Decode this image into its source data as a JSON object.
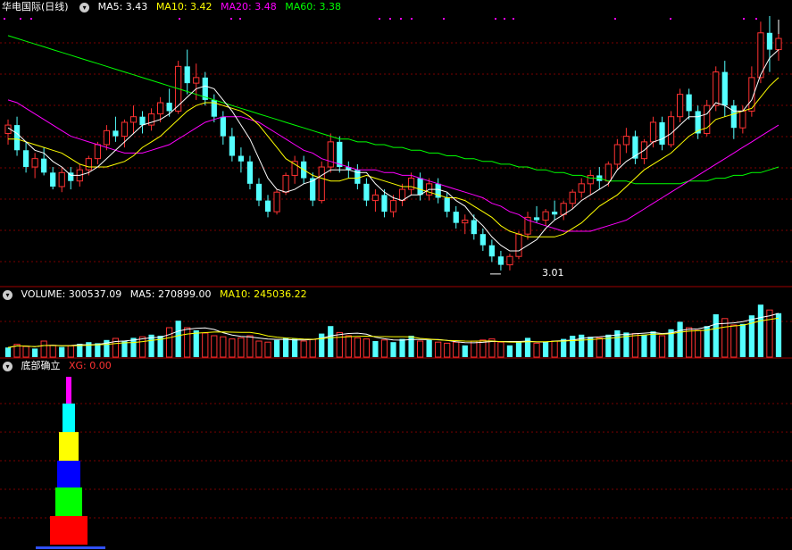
{
  "price_panel": {
    "title": "华电国际(日线)",
    "ma5_label": "MA5: 3.43",
    "ma10_label": "MA10: 3.42",
    "ma20_label": "MA20: 3.48",
    "ma60_label": "MA60: 3.38",
    "low_marker": "3.01",
    "colors": {
      "ma5": "#ffffff",
      "ma10": "#ffff00",
      "ma20": "#ff00ff",
      "ma60": "#00ff00",
      "up": "#ff3232",
      "down": "#54ffff"
    }
  },
  "volume_panel": {
    "volume_label": "VOLUME: 300537.09",
    "ma5_label": "MA5: 270899.00",
    "ma10_label": "MA10: 245036.22"
  },
  "indicator_panel": {
    "title": "底部确立",
    "xg_label": "XG: 0.00",
    "tower_colors": [
      "#ff0000",
      "#00ff00",
      "#0000ff",
      "#ffff00",
      "#00ffff",
      "#ff00ff"
    ]
  },
  "chart_data": {
    "type": "candlestick",
    "title": "华电国际(日线)",
    "candles": [
      [
        3.5,
        3.55,
        3.46,
        3.53
      ],
      [
        3.53,
        3.56,
        3.42,
        3.44
      ],
      [
        3.44,
        3.47,
        3.36,
        3.38
      ],
      [
        3.38,
        3.43,
        3.34,
        3.41
      ],
      [
        3.41,
        3.45,
        3.35,
        3.36
      ],
      [
        3.36,
        3.38,
        3.3,
        3.31
      ],
      [
        3.31,
        3.38,
        3.29,
        3.36
      ],
      [
        3.36,
        3.38,
        3.3,
        3.33
      ],
      [
        3.33,
        3.39,
        3.31,
        3.37
      ],
      [
        3.37,
        3.42,
        3.35,
        3.41
      ],
      [
        3.41,
        3.47,
        3.39,
        3.46
      ],
      [
        3.46,
        3.53,
        3.44,
        3.51
      ],
      [
        3.51,
        3.56,
        3.47,
        3.49
      ],
      [
        3.49,
        3.55,
        3.45,
        3.54
      ],
      [
        3.54,
        3.6,
        3.5,
        3.56
      ],
      [
        3.56,
        3.58,
        3.5,
        3.53
      ],
      [
        3.53,
        3.59,
        3.51,
        3.57
      ],
      [
        3.57,
        3.63,
        3.54,
        3.61
      ],
      [
        3.61,
        3.66,
        3.56,
        3.58
      ],
      [
        3.58,
        3.76,
        3.57,
        3.74
      ],
      [
        3.74,
        3.8,
        3.64,
        3.68
      ],
      [
        3.68,
        3.75,
        3.62,
        3.7
      ],
      [
        3.7,
        3.72,
        3.6,
        3.62
      ],
      [
        3.62,
        3.64,
        3.54,
        3.56
      ],
      [
        3.56,
        3.58,
        3.46,
        3.49
      ],
      [
        3.49,
        3.52,
        3.4,
        3.42
      ],
      [
        3.42,
        3.45,
        3.36,
        3.4
      ],
      [
        3.4,
        3.42,
        3.3,
        3.32
      ],
      [
        3.32,
        3.34,
        3.24,
        3.26
      ],
      [
        3.26,
        3.28,
        3.2,
        3.22
      ],
      [
        3.22,
        3.3,
        3.21,
        3.29
      ],
      [
        3.29,
        3.36,
        3.28,
        3.35
      ],
      [
        3.35,
        3.42,
        3.32,
        3.4
      ],
      [
        3.4,
        3.42,
        3.32,
        3.34
      ],
      [
        3.34,
        3.36,
        3.24,
        3.26
      ],
      [
        3.26,
        3.4,
        3.25,
        3.38
      ],
      [
        3.38,
        3.5,
        3.36,
        3.47
      ],
      [
        3.47,
        3.49,
        3.36,
        3.38
      ],
      [
        3.38,
        3.4,
        3.34,
        3.37
      ],
      [
        3.37,
        3.39,
        3.3,
        3.32
      ],
      [
        3.32,
        3.34,
        3.24,
        3.26
      ],
      [
        3.26,
        3.3,
        3.22,
        3.28
      ],
      [
        3.28,
        3.3,
        3.2,
        3.22
      ],
      [
        3.22,
        3.28,
        3.2,
        3.26
      ],
      [
        3.26,
        3.32,
        3.24,
        3.3
      ],
      [
        3.3,
        3.36,
        3.28,
        3.34
      ],
      [
        3.34,
        3.36,
        3.26,
        3.28
      ],
      [
        3.28,
        3.34,
        3.26,
        3.32
      ],
      [
        3.32,
        3.34,
        3.25,
        3.27
      ],
      [
        3.27,
        3.29,
        3.2,
        3.22
      ],
      [
        3.22,
        3.24,
        3.16,
        3.18
      ],
      [
        3.18,
        3.21,
        3.14,
        3.19
      ],
      [
        3.19,
        3.21,
        3.12,
        3.14
      ],
      [
        3.14,
        3.16,
        3.08,
        3.1
      ],
      [
        3.1,
        3.12,
        3.04,
        3.06
      ],
      [
        3.06,
        3.08,
        3.01,
        3.03
      ],
      [
        3.03,
        3.07,
        3.01,
        3.06
      ],
      [
        3.06,
        3.15,
        3.05,
        3.14
      ],
      [
        3.14,
        3.22,
        3.12,
        3.2
      ],
      [
        3.2,
        3.24,
        3.18,
        3.19
      ],
      [
        3.19,
        3.23,
        3.17,
        3.22
      ],
      [
        3.22,
        3.26,
        3.19,
        3.21
      ],
      [
        3.21,
        3.26,
        3.19,
        3.25
      ],
      [
        3.25,
        3.3,
        3.23,
        3.29
      ],
      [
        3.29,
        3.34,
        3.27,
        3.32
      ],
      [
        3.32,
        3.37,
        3.28,
        3.35
      ],
      [
        3.35,
        3.38,
        3.3,
        3.33
      ],
      [
        3.33,
        3.4,
        3.31,
        3.39
      ],
      [
        3.39,
        3.48,
        3.37,
        3.46
      ],
      [
        3.46,
        3.52,
        3.43,
        3.49
      ],
      [
        3.49,
        3.51,
        3.39,
        3.41
      ],
      [
        3.41,
        3.48,
        3.39,
        3.47
      ],
      [
        3.47,
        3.56,
        3.45,
        3.54
      ],
      [
        3.54,
        3.56,
        3.44,
        3.46
      ],
      [
        3.46,
        3.58,
        3.45,
        3.56
      ],
      [
        3.56,
        3.66,
        3.54,
        3.64
      ],
      [
        3.64,
        3.66,
        3.55,
        3.58
      ],
      [
        3.58,
        3.6,
        3.48,
        3.5
      ],
      [
        3.5,
        3.62,
        3.49,
        3.6
      ],
      [
        3.6,
        3.74,
        3.58,
        3.72
      ],
      [
        3.72,
        3.76,
        3.56,
        3.6
      ],
      [
        3.6,
        3.62,
        3.48,
        3.52
      ],
      [
        3.52,
        3.6,
        3.5,
        3.58
      ],
      [
        3.58,
        3.74,
        3.56,
        3.7
      ],
      [
        3.7,
        3.9,
        3.68,
        3.86
      ],
      [
        3.86,
        3.92,
        3.72,
        3.8
      ],
      [
        3.8,
        3.86,
        3.76,
        3.84
      ]
    ],
    "volumes": [
      [
        false,
        0.18
      ],
      [
        true,
        0.24
      ],
      [
        true,
        0.2
      ],
      [
        false,
        0.16
      ],
      [
        true,
        0.3
      ],
      [
        true,
        0.22
      ],
      [
        false,
        0.19
      ],
      [
        true,
        0.21
      ],
      [
        false,
        0.25
      ],
      [
        false,
        0.28
      ],
      [
        false,
        0.26
      ],
      [
        false,
        0.32
      ],
      [
        true,
        0.35
      ],
      [
        false,
        0.3
      ],
      [
        false,
        0.36
      ],
      [
        true,
        0.38
      ],
      [
        false,
        0.42
      ],
      [
        false,
        0.4
      ],
      [
        true,
        0.55
      ],
      [
        false,
        0.68
      ],
      [
        true,
        0.55
      ],
      [
        false,
        0.5
      ],
      [
        true,
        0.45
      ],
      [
        true,
        0.4
      ],
      [
        true,
        0.38
      ],
      [
        true,
        0.34
      ],
      [
        true,
        0.36
      ],
      [
        true,
        0.4
      ],
      [
        true,
        0.3
      ],
      [
        true,
        0.28
      ],
      [
        false,
        0.32
      ],
      [
        false,
        0.36
      ],
      [
        false,
        0.34
      ],
      [
        true,
        0.3
      ],
      [
        true,
        0.33
      ],
      [
        false,
        0.44
      ],
      [
        false,
        0.58
      ],
      [
        true,
        0.46
      ],
      [
        true,
        0.4
      ],
      [
        true,
        0.36
      ],
      [
        true,
        0.34
      ],
      [
        false,
        0.3
      ],
      [
        true,
        0.32
      ],
      [
        false,
        0.28
      ],
      [
        false,
        0.34
      ],
      [
        false,
        0.4
      ],
      [
        true,
        0.3
      ],
      [
        false,
        0.32
      ],
      [
        true,
        0.28
      ],
      [
        true,
        0.26
      ],
      [
        true,
        0.28
      ],
      [
        false,
        0.22
      ],
      [
        true,
        0.3
      ],
      [
        true,
        0.32
      ],
      [
        true,
        0.34
      ],
      [
        true,
        0.28
      ],
      [
        false,
        0.22
      ],
      [
        false,
        0.3
      ],
      [
        false,
        0.36
      ],
      [
        true,
        0.26
      ],
      [
        false,
        0.28
      ],
      [
        true,
        0.3
      ],
      [
        false,
        0.34
      ],
      [
        false,
        0.4
      ],
      [
        false,
        0.42
      ],
      [
        false,
        0.38
      ],
      [
        true,
        0.36
      ],
      [
        false,
        0.42
      ],
      [
        false,
        0.5
      ],
      [
        false,
        0.46
      ],
      [
        true,
        0.44
      ],
      [
        false,
        0.42
      ],
      [
        false,
        0.48
      ],
      [
        true,
        0.4
      ],
      [
        false,
        0.52
      ],
      [
        false,
        0.66
      ],
      [
        true,
        0.55
      ],
      [
        true,
        0.5
      ],
      [
        false,
        0.58
      ],
      [
        false,
        0.8
      ],
      [
        true,
        0.72
      ],
      [
        true,
        0.6
      ],
      [
        false,
        0.62
      ],
      [
        false,
        0.78
      ],
      [
        false,
        0.98
      ],
      [
        true,
        0.88
      ],
      [
        false,
        0.82
      ]
    ],
    "ma5": [
      3.52,
      3.5,
      3.47,
      3.44,
      3.43,
      3.4,
      3.38,
      3.35,
      3.35,
      3.36,
      3.38,
      3.41,
      3.44,
      3.47,
      3.5,
      3.53,
      3.54,
      3.55,
      3.57,
      3.6,
      3.63,
      3.66,
      3.67,
      3.66,
      3.62,
      3.58,
      3.53,
      3.48,
      3.41,
      3.34,
      3.3,
      3.29,
      3.3,
      3.32,
      3.33,
      3.35,
      3.37,
      3.37,
      3.37,
      3.36,
      3.36,
      3.32,
      3.29,
      3.27,
      3.26,
      3.28,
      3.28,
      3.3,
      3.3,
      3.29,
      3.26,
      3.24,
      3.2,
      3.17,
      3.13,
      3.1,
      3.08,
      3.08,
      3.1,
      3.12,
      3.16,
      3.19,
      3.21,
      3.23,
      3.26,
      3.28,
      3.3,
      3.32,
      3.37,
      3.4,
      3.42,
      3.44,
      3.47,
      3.48,
      3.5,
      3.53,
      3.56,
      3.56,
      3.57,
      3.61,
      3.6,
      3.58,
      3.58,
      3.62,
      3.71,
      3.77,
      3.8
    ],
    "ma10": [
      3.48,
      3.48,
      3.47,
      3.46,
      3.45,
      3.44,
      3.43,
      3.41,
      3.39,
      3.38,
      3.38,
      3.38,
      3.39,
      3.4,
      3.42,
      3.45,
      3.47,
      3.49,
      3.52,
      3.55,
      3.58,
      3.6,
      3.61,
      3.61,
      3.6,
      3.59,
      3.58,
      3.56,
      3.53,
      3.49,
      3.45,
      3.41,
      3.39,
      3.37,
      3.35,
      3.34,
      3.33,
      3.33,
      3.34,
      3.34,
      3.35,
      3.34,
      3.33,
      3.32,
      3.31,
      3.31,
      3.3,
      3.29,
      3.28,
      3.27,
      3.27,
      3.26,
      3.24,
      3.22,
      3.2,
      3.17,
      3.15,
      3.14,
      3.13,
      3.13,
      3.13,
      3.13,
      3.14,
      3.16,
      3.18,
      3.21,
      3.24,
      3.26,
      3.28,
      3.31,
      3.34,
      3.37,
      3.39,
      3.41,
      3.43,
      3.46,
      3.49,
      3.51,
      3.52,
      3.55,
      3.56,
      3.57,
      3.58,
      3.59,
      3.63,
      3.67,
      3.7
    ],
    "ma20": [
      3.62,
      3.61,
      3.59,
      3.57,
      3.55,
      3.53,
      3.51,
      3.49,
      3.48,
      3.47,
      3.46,
      3.45,
      3.44,
      3.43,
      3.43,
      3.43,
      3.44,
      3.45,
      3.46,
      3.48,
      3.5,
      3.52,
      3.54,
      3.55,
      3.56,
      3.56,
      3.56,
      3.55,
      3.54,
      3.52,
      3.5,
      3.48,
      3.46,
      3.44,
      3.43,
      3.41,
      3.4,
      3.39,
      3.38,
      3.37,
      3.37,
      3.37,
      3.36,
      3.36,
      3.35,
      3.35,
      3.34,
      3.33,
      3.32,
      3.31,
      3.3,
      3.29,
      3.28,
      3.27,
      3.25,
      3.24,
      3.22,
      3.21,
      3.19,
      3.18,
      3.17,
      3.16,
      3.15,
      3.15,
      3.15,
      3.15,
      3.16,
      3.17,
      3.18,
      3.19,
      3.21,
      3.23,
      3.25,
      3.27,
      3.29,
      3.31,
      3.33,
      3.35,
      3.37,
      3.39,
      3.41,
      3.43,
      3.45,
      3.47,
      3.49,
      3.51,
      3.53
    ],
    "ma60": [
      3.85,
      3.84,
      3.83,
      3.82,
      3.81,
      3.8,
      3.79,
      3.78,
      3.77,
      3.76,
      3.75,
      3.74,
      3.73,
      3.72,
      3.71,
      3.7,
      3.69,
      3.68,
      3.67,
      3.66,
      3.65,
      3.64,
      3.63,
      3.62,
      3.61,
      3.6,
      3.59,
      3.58,
      3.57,
      3.56,
      3.55,
      3.54,
      3.53,
      3.52,
      3.51,
      3.5,
      3.49,
      3.48,
      3.48,
      3.47,
      3.47,
      3.46,
      3.46,
      3.45,
      3.45,
      3.44,
      3.44,
      3.43,
      3.43,
      3.42,
      3.42,
      3.41,
      3.41,
      3.4,
      3.4,
      3.39,
      3.39,
      3.38,
      3.38,
      3.37,
      3.37,
      3.36,
      3.36,
      3.35,
      3.35,
      3.34,
      3.34,
      3.33,
      3.33,
      3.33,
      3.32,
      3.32,
      3.32,
      3.32,
      3.32,
      3.32,
      3.33,
      3.33,
      3.33,
      3.34,
      3.34,
      3.35,
      3.35,
      3.36,
      3.36,
      3.37,
      3.38
    ]
  }
}
